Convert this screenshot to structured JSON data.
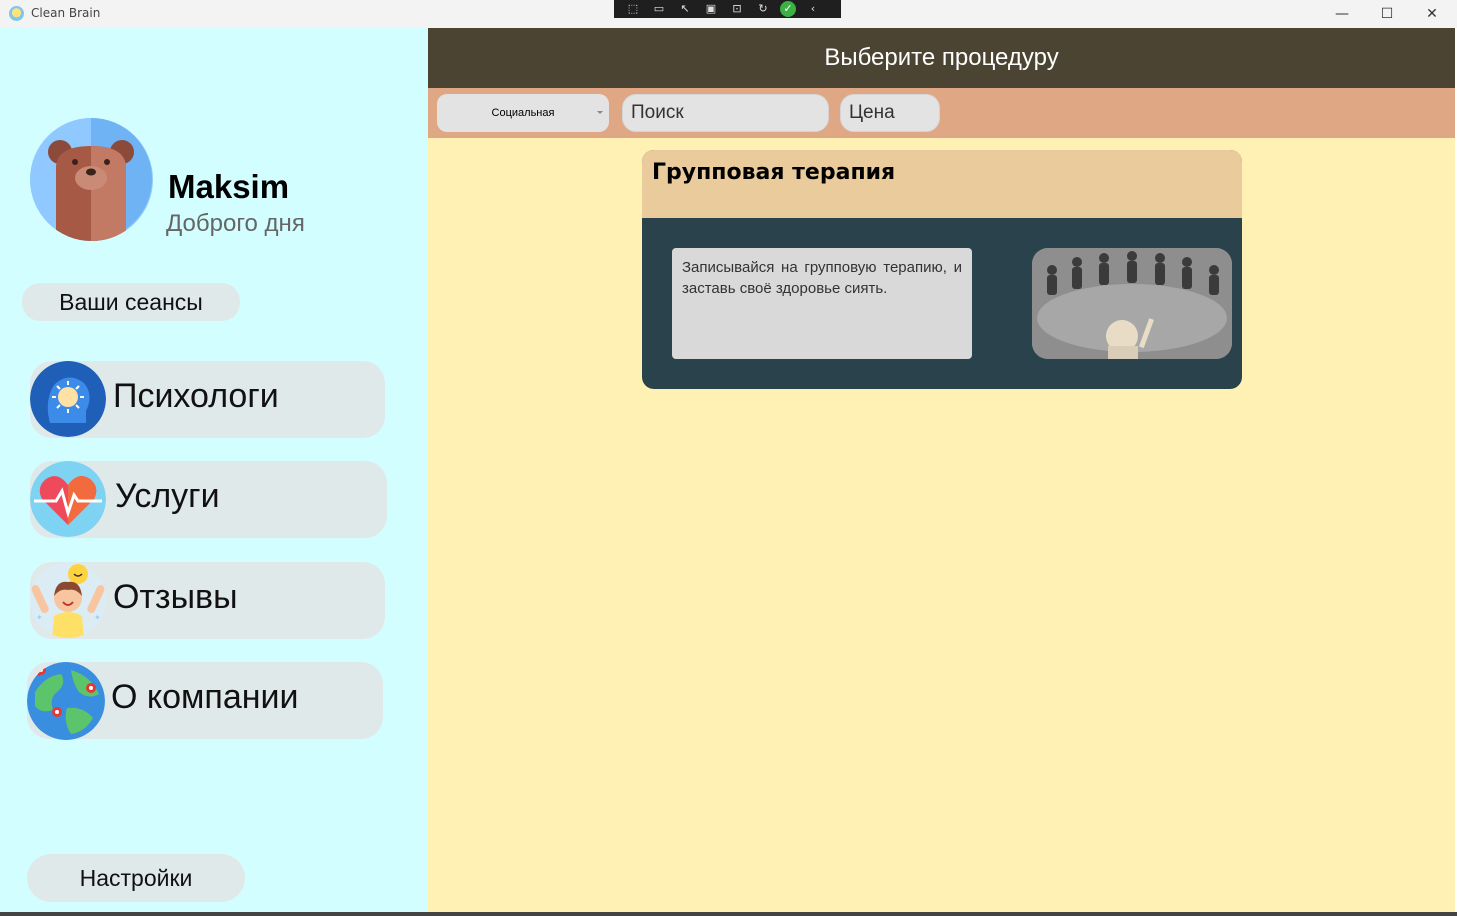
{
  "window": {
    "title": "Clean Brain",
    "controls": {
      "minimize": "—",
      "maximize": "☐",
      "close": "✕"
    }
  },
  "debug_toolbar": {
    "icons": [
      "select-element-icon",
      "record-icon",
      "pointer-icon",
      "frame-icon",
      "inspect-icon",
      "hot-reload-icon",
      "ok-icon",
      "collapse-icon"
    ]
  },
  "sidebar": {
    "user": {
      "name": "Maksim",
      "greeting": "Доброго дня"
    },
    "sessions_label": "Ваши сеансы",
    "nav": [
      {
        "label": "Психологи",
        "icon": "brain-head-icon"
      },
      {
        "label": "Услуги",
        "icon": "heart-pulse-icon"
      },
      {
        "label": "Отзывы",
        "icon": "happy-girl-icon"
      },
      {
        "label": "О компании",
        "icon": "globe-pins-icon"
      }
    ],
    "settings_label": "Настройки"
  },
  "main": {
    "header_title": "Выберите процедуру",
    "filters": {
      "category_selected": "Социальная",
      "search_placeholder": "Поиск",
      "price_placeholder": "Цена"
    },
    "cards": [
      {
        "title": "Групповая терапия",
        "description": "Записывайся на групповую терапию, и заставь своё здоровье сиять.",
        "image": "group-therapy-photo"
      }
    ]
  },
  "colors": {
    "sidebar_bg": "#d3feff",
    "main_bg": "#fff1b3",
    "header_bg": "#4c4432",
    "filterbar_bg": "#dfa784",
    "card_head_bg": "#eacb9b",
    "card_body_bg": "#29424c"
  }
}
